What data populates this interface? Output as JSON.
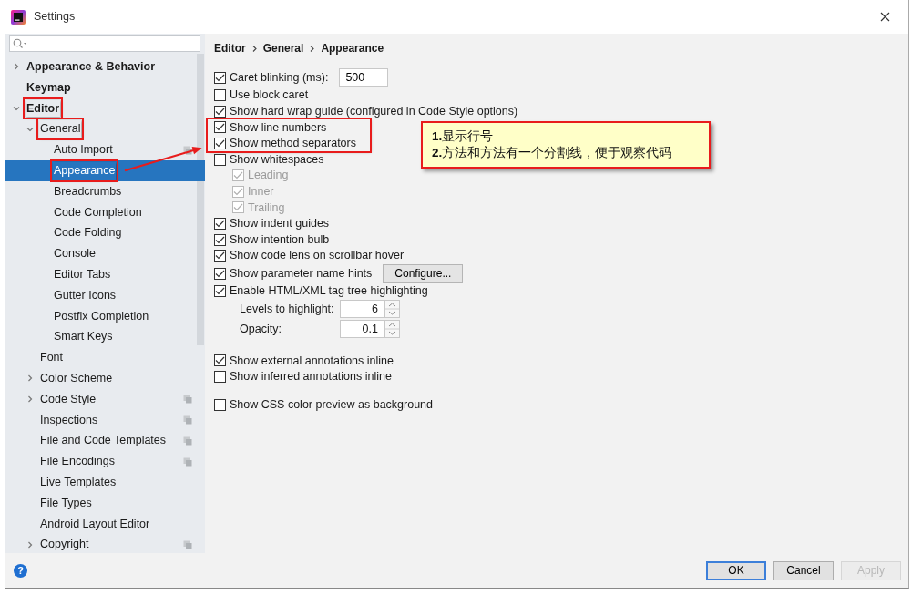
{
  "window": {
    "title": "Settings"
  },
  "sidebar": {
    "items": [
      {
        "label": "Appearance & Behavior",
        "expanded": false,
        "selected": false,
        "scoped": false,
        "annotated": false
      },
      {
        "label": "Keymap",
        "selected": false,
        "scoped": false,
        "annotated": false
      },
      {
        "label": "Editor",
        "expanded": true,
        "selected": false,
        "scoped": false,
        "annotated": true,
        "children": [
          {
            "label": "General",
            "expanded": true,
            "selected": false,
            "scoped": false,
            "annotated": true,
            "children": [
              {
                "label": "Auto Import",
                "selected": false,
                "scoped": true,
                "annotated": false
              },
              {
                "label": "Appearance",
                "selected": true,
                "scoped": false,
                "annotated": true
              },
              {
                "label": "Breadcrumbs",
                "selected": false,
                "scoped": false,
                "annotated": false
              },
              {
                "label": "Code Completion",
                "selected": false,
                "scoped": false,
                "annotated": false
              },
              {
                "label": "Code Folding",
                "selected": false,
                "scoped": false,
                "annotated": false
              },
              {
                "label": "Console",
                "selected": false,
                "scoped": false,
                "annotated": false
              },
              {
                "label": "Editor Tabs",
                "selected": false,
                "scoped": false,
                "annotated": false
              },
              {
                "label": "Gutter Icons",
                "selected": false,
                "scoped": false,
                "annotated": false
              },
              {
                "label": "Postfix Completion",
                "selected": false,
                "scoped": false,
                "annotated": false
              },
              {
                "label": "Smart Keys",
                "selected": false,
                "scoped": false,
                "annotated": false
              }
            ]
          },
          {
            "label": "Font",
            "selected": false,
            "scoped": false,
            "annotated": false
          },
          {
            "label": "Color Scheme",
            "expanded": false,
            "selected": false,
            "scoped": false,
            "annotated": false
          },
          {
            "label": "Code Style",
            "expanded": false,
            "selected": false,
            "scoped": true,
            "annotated": false
          },
          {
            "label": "Inspections",
            "selected": false,
            "scoped": true,
            "annotated": false
          },
          {
            "label": "File and Code Templates",
            "selected": false,
            "scoped": true,
            "annotated": false
          },
          {
            "label": "File Encodings",
            "selected": false,
            "scoped": true,
            "annotated": false
          },
          {
            "label": "Live Templates",
            "selected": false,
            "scoped": false,
            "annotated": false
          },
          {
            "label": "File Types",
            "selected": false,
            "scoped": false,
            "annotated": false
          },
          {
            "label": "Android Layout Editor",
            "selected": false,
            "scoped": false,
            "annotated": false
          },
          {
            "label": "Copyright",
            "expanded": false,
            "selected": false,
            "scoped": true,
            "annotated": false
          }
        ]
      }
    ]
  },
  "breadcrumb": [
    "Editor",
    "General",
    "Appearance"
  ],
  "option_groups": [
    [
      {
        "kind": "checkbox",
        "label": "Caret blinking (ms):",
        "checked": true,
        "disabled": false,
        "annotated": false,
        "value": "500"
      },
      {
        "kind": "checkbox",
        "label": "Use block caret",
        "checked": false,
        "disabled": false,
        "annotated": false
      },
      {
        "kind": "checkbox",
        "label": "Show hard wrap guide (configured in Code Style options)",
        "checked": true,
        "disabled": false,
        "annotated": false
      },
      {
        "kind": "checkbox",
        "label": "Show line numbers",
        "checked": true,
        "disabled": false,
        "annotated": true
      },
      {
        "kind": "checkbox",
        "label": "Show method separators",
        "checked": true,
        "disabled": false,
        "annotated": true
      },
      {
        "kind": "checkbox",
        "label": "Show whitespaces",
        "checked": false,
        "disabled": false,
        "annotated": false,
        "children": [
          {
            "kind": "checkbox",
            "label": "Leading",
            "checked": true,
            "disabled": true
          },
          {
            "kind": "checkbox",
            "label": "Inner",
            "checked": true,
            "disabled": true
          },
          {
            "kind": "checkbox",
            "label": "Trailing",
            "checked": true,
            "disabled": true
          }
        ]
      },
      {
        "kind": "checkbox",
        "label": "Show indent guides",
        "checked": true,
        "disabled": false,
        "annotated": false
      },
      {
        "kind": "checkbox",
        "label": "Show intention bulb",
        "checked": true,
        "disabled": false,
        "annotated": false
      },
      {
        "kind": "checkbox",
        "label": "Show code lens on scrollbar hover",
        "checked": true,
        "disabled": false,
        "annotated": false
      },
      {
        "kind": "checkbox",
        "label": "Show parameter name hints",
        "checked": true,
        "disabled": false,
        "annotated": false,
        "button": "Configure..."
      },
      {
        "kind": "checkbox",
        "label": "Enable HTML/XML tag tree highlighting",
        "checked": true,
        "disabled": false,
        "annotated": false,
        "children": [
          {
            "kind": "spinner",
            "label": "Levels to highlight:",
            "value": "6"
          },
          {
            "kind": "spinner",
            "label": "Opacity:",
            "value": "0.1"
          }
        ]
      }
    ],
    [
      {
        "kind": "checkbox",
        "label": "Show external annotations inline",
        "checked": true,
        "disabled": false,
        "annotated": false
      },
      {
        "kind": "checkbox",
        "label": "Show inferred annotations inline",
        "checked": false,
        "disabled": false,
        "annotated": false
      }
    ],
    [
      {
        "kind": "checkbox",
        "label": "Show CSS color preview as background",
        "checked": false,
        "disabled": false,
        "annotated": false
      }
    ]
  ],
  "annotation": {
    "lines": [
      "**1.**显示行号",
      "**2.**方法和方法有一个分割线，便于观察代码"
    ]
  },
  "help_button": "?",
  "buttons": [
    {
      "label": "OK",
      "default": true,
      "disabled": false
    },
    {
      "label": "Cancel",
      "default": false,
      "disabled": false
    },
    {
      "label": "Apply",
      "default": false,
      "disabled": true
    }
  ]
}
